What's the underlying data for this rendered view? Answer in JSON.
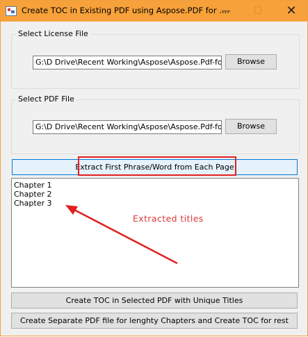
{
  "window": {
    "title": "Create TOC in Existing PDF using Aspose.PDF for ....",
    "controls": {
      "minimize": "—",
      "maximize": "☐",
      "close": "✕"
    },
    "colors": {
      "titlebar": "#f7a13a",
      "annotation": "#d93a3a",
      "highlight_border": "#e02020"
    }
  },
  "license": {
    "label": "Select License File",
    "path": "G:\\D Drive\\Recent Working\\Aspose\\Aspose.Pdf-for-.N",
    "browse_label": "Browse"
  },
  "pdf": {
    "label": "Select PDF File",
    "path": "G:\\D Drive\\Recent Working\\Aspose\\Aspose.Pdf-for-.N",
    "browse_label": "Browse"
  },
  "extract_button_label": "Extract First Phrase/Word from Each Page",
  "titles_list": {
    "items": [
      "Chapter 1",
      "Chapter 2",
      "Chapter 3"
    ]
  },
  "annotation": {
    "text": "Extracted titles"
  },
  "create_toc_label": "Create TOC in Selected PDF with Unique Titles",
  "create_separate_label": "Create Separate PDF file for lenghty Chapters and Create TOC for rest"
}
